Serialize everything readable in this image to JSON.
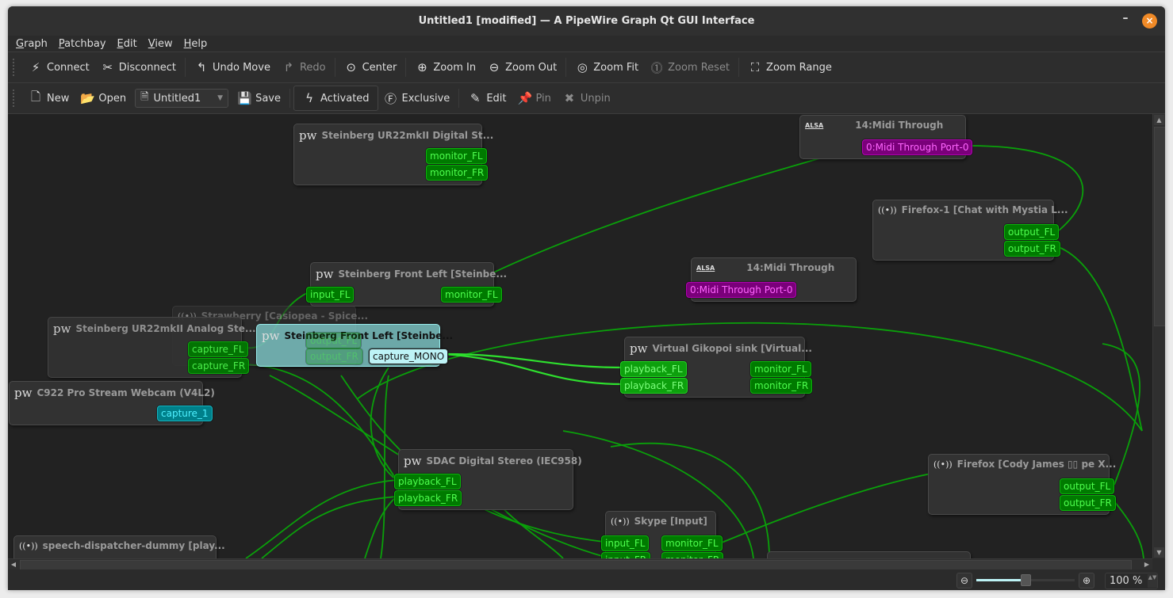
{
  "window": {
    "title": "Untitled1 [modified] — A PipeWire Graph Qt GUI Interface",
    "minimize_label": "–",
    "close_label": "×"
  },
  "menu": [
    {
      "label": "Graph",
      "accel": "G",
      "rest": "raph"
    },
    {
      "label": "Patchbay",
      "accel": "P",
      "rest": "atchbay"
    },
    {
      "label": "Edit",
      "accel": "E",
      "rest": "dit"
    },
    {
      "label": "View",
      "accel": "V",
      "rest": "iew"
    },
    {
      "label": "Help",
      "accel": "H",
      "rest": "elp"
    }
  ],
  "toolbar1": {
    "connect": {
      "label": "Connect",
      "icon": "connect-icon",
      "glyph": "⚡"
    },
    "disconnect": {
      "label": "Disconnect",
      "icon": "disconnect-icon",
      "glyph": "✂"
    },
    "undo": {
      "label": "Undo Move",
      "icon": "undo-icon",
      "glyph": "↰"
    },
    "redo": {
      "label": "Redo",
      "icon": "redo-icon",
      "glyph": "↱"
    },
    "center": {
      "label": "Center",
      "icon": "center-icon",
      "glyph": "⊙"
    },
    "zoom_in": {
      "label": "Zoom In",
      "icon": "zoom-in-icon",
      "glyph": "⊕"
    },
    "zoom_out": {
      "label": "Zoom Out",
      "icon": "zoom-out-icon",
      "glyph": "⊖"
    },
    "zoom_fit": {
      "label": "Zoom Fit",
      "icon": "zoom-fit-icon",
      "glyph": "◎"
    },
    "zoom_reset": {
      "label": "Zoom Reset",
      "icon": "zoom-reset-icon",
      "glyph": "⓵"
    },
    "zoom_range": {
      "label": "Zoom Range",
      "icon": "zoom-range-icon",
      "glyph": "⛶"
    }
  },
  "toolbar2": {
    "new": {
      "label": "New",
      "glyph": "🗋"
    },
    "open": {
      "label": "Open",
      "glyph": "📂"
    },
    "patchbay_combo": {
      "value": "Untitled1",
      "glyph": "🗎",
      "arrow": "▼"
    },
    "save": {
      "label": "Save",
      "glyph": "💾"
    },
    "activated": {
      "label": "Activated",
      "glyph": "ϟ"
    },
    "exclusive": {
      "label": "Exclusive",
      "glyph": "Ⓕ"
    },
    "edit": {
      "label": "Edit",
      "glyph": "✎"
    },
    "pin": {
      "label": "Pin",
      "glyph": "📌"
    },
    "unpin": {
      "label": "Unpin",
      "glyph": "✖"
    }
  },
  "nodes": {
    "ur22_digital": {
      "title": "Steinberg UR22mkII Digital St...",
      "icon": "pw",
      "ports": [
        "monitor_FL",
        "monitor_FR"
      ]
    },
    "midi_through_1": {
      "title": "14:Midi Through",
      "icon": "ALSA",
      "ports": [
        "0:Midi Through Port-0"
      ]
    },
    "firefox1": {
      "title": "Firefox-1 [Chat with Mystia L...",
      "icon": "((•))",
      "ports": [
        "output_FL",
        "output_FR"
      ]
    },
    "front_left_1": {
      "title": "Steinberg Front Left [Steinbe...",
      "icon": "pw",
      "ports": [
        "input_FL",
        "monitor_FL"
      ]
    },
    "midi_through_2": {
      "title": "14:Midi Through",
      "icon": "ALSA",
      "ports": [
        "0:Midi Through Port-0"
      ]
    },
    "strawberry": {
      "title": "Strawberry [Casiopea - Spice...",
      "icon": "((•))"
    },
    "ur22_analog": {
      "title": "Steinberg UR22mkII Analog Ste...",
      "icon": "pw",
      "ports": [
        "capture_FL",
        "capture_FR"
      ]
    },
    "front_left_sel": {
      "title": "Steinberg Front Left [Steinbe...",
      "icon": "pw",
      "ports": [
        "output_FL",
        "output_FR",
        "capture_MONO"
      ]
    },
    "gikopoi": {
      "title": "Virtual Gikopoi sink [Virtual...",
      "icon": "pw",
      "ports": [
        "playback_FL",
        "playback_FR",
        "monitor_FL",
        "monitor_FR"
      ]
    },
    "webcam": {
      "title": "C922 Pro Stream Webcam (V4L2)",
      "icon": "pw",
      "ports": [
        "capture_1"
      ]
    },
    "sdac": {
      "title": "SDAC Digital Stereo (IEC958)",
      "icon": "pw",
      "ports": [
        "playback_FL",
        "playback_FR"
      ]
    },
    "firefox": {
      "title": "Firefox [Cody James ▯▯ pe X...",
      "icon": "((•))",
      "ports": [
        "output_FL",
        "output_FR"
      ]
    },
    "skype": {
      "title": "Skype [Input]",
      "icon": "((•))",
      "ports": [
        "input_FL",
        "monitor_FL",
        "input_FR",
        "monitor_FR"
      ]
    },
    "speech": {
      "title": "speech-dispatcher-dummy [play...",
      "icon": "((•))"
    }
  },
  "colors": {
    "audio_port": "#007a00",
    "audio_text": "#4eff4e",
    "midi_port": "#7a007a",
    "midi_text": "#ff66ff",
    "video_port": "#00808a",
    "wire": "#0aa00a",
    "selected_node": "#81cece",
    "canvas_bg": "#222222"
  },
  "status": {
    "zoom_value": "100 %",
    "zoom_slider_percent": 50,
    "zoom_out_glyph": "⊖",
    "zoom_in_glyph": "⊕",
    "spin_arrows": "▲▼"
  },
  "scroll": {
    "up": "▲",
    "down": "▼",
    "left": "◀",
    "right": "▶"
  }
}
